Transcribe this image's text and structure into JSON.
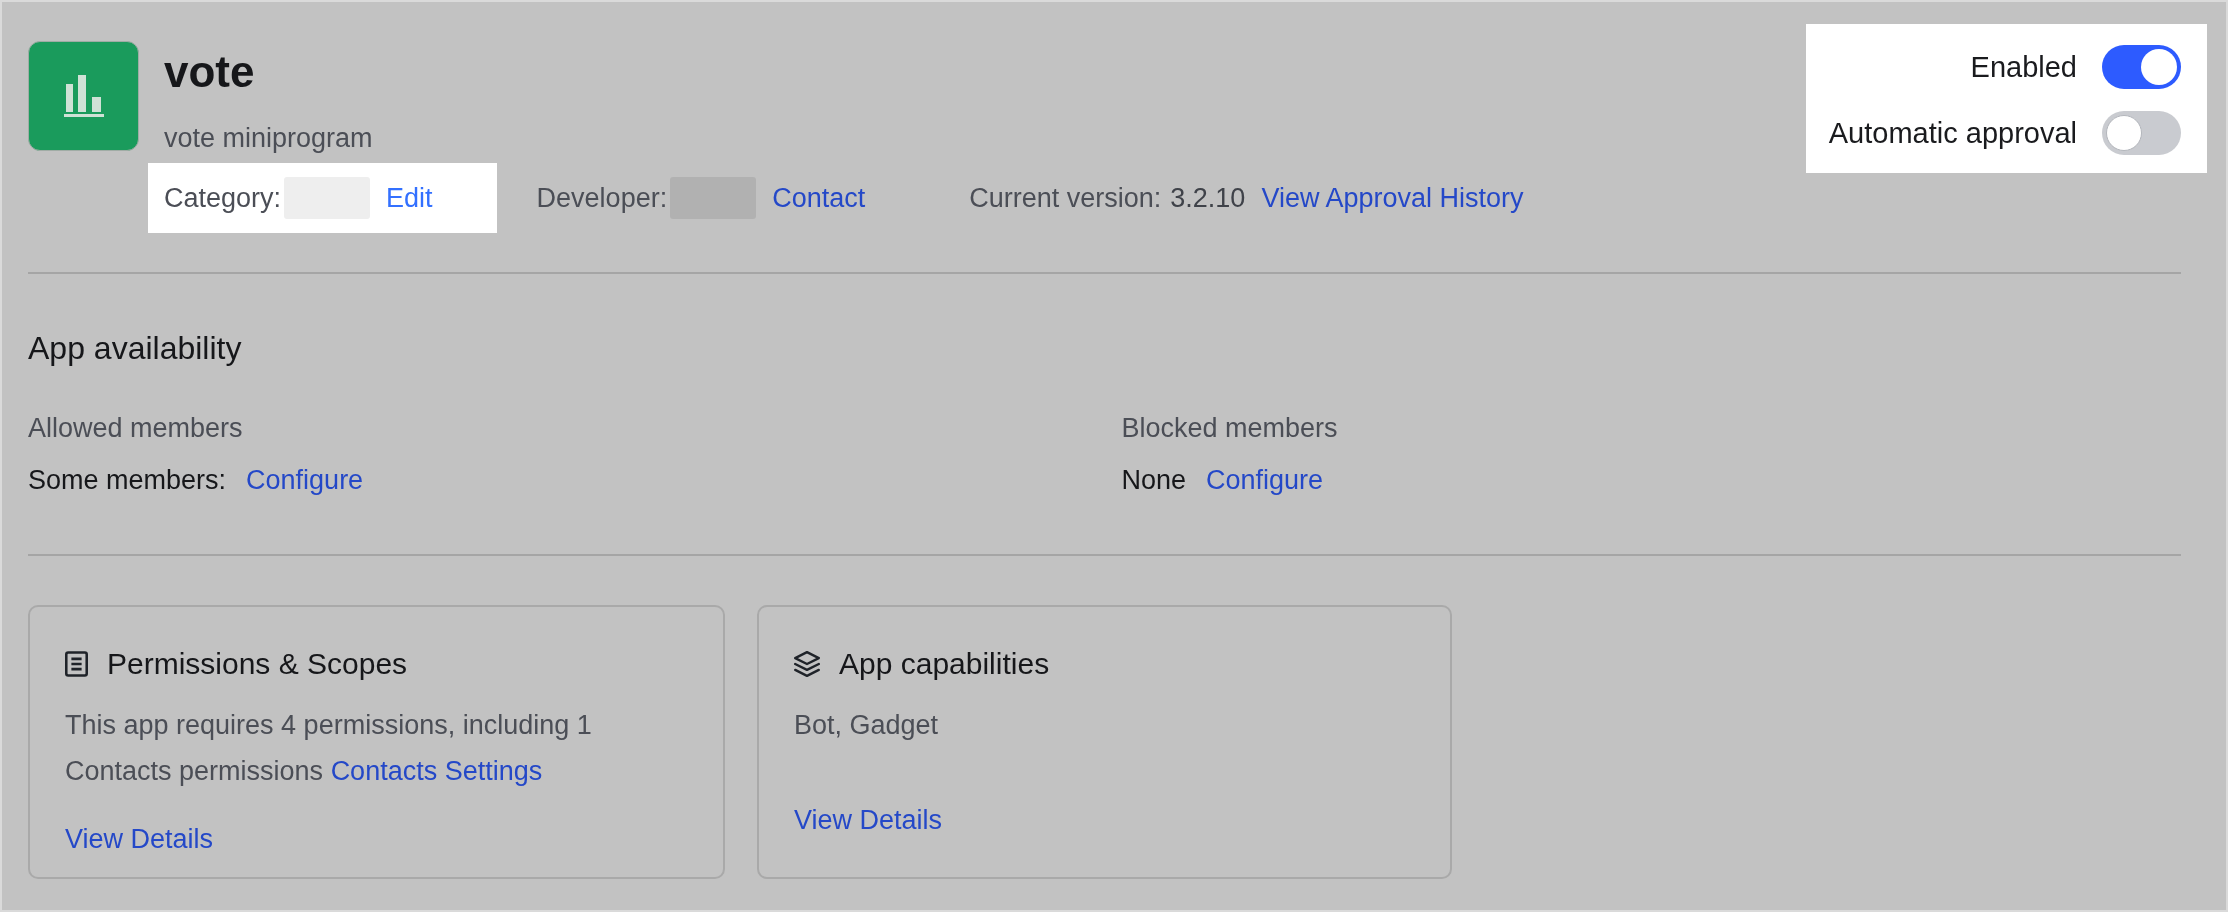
{
  "app": {
    "name": "vote",
    "description": "vote miniprogram"
  },
  "meta": [
    {
      "label": "Category:",
      "redacted": true,
      "link": "Edit",
      "highlighted": true
    },
    {
      "label": "Developer:",
      "redacted": true,
      "link": "Contact",
      "highlighted": false
    },
    {
      "label": "Current version:",
      "value": "3.2.10",
      "redacted": false,
      "link": "View Approval History",
      "highlighted": false
    }
  ],
  "switch_panel": {
    "highlighted": true,
    "switches": [
      {
        "label": "Enabled",
        "on": true
      },
      {
        "label": "Automatic approval",
        "on": false
      }
    ]
  },
  "availability": {
    "title": "App availability",
    "groups": [
      {
        "label": "Allowed members",
        "value": "Some members:",
        "link": "Configure"
      },
      {
        "label": "Blocked members",
        "value": "None",
        "link": "Configure"
      }
    ]
  },
  "cards": [
    {
      "kind": "permissions",
      "title": "Permissions & Scopes",
      "text": "This app requires 4 permissions, including 1 Contacts permissions",
      "link": "Contacts Settings",
      "action": "View Details"
    },
    {
      "kind": "capabilities",
      "title": "App capabilities",
      "text": "Bot, Gadget",
      "action": "View Details"
    }
  ]
}
